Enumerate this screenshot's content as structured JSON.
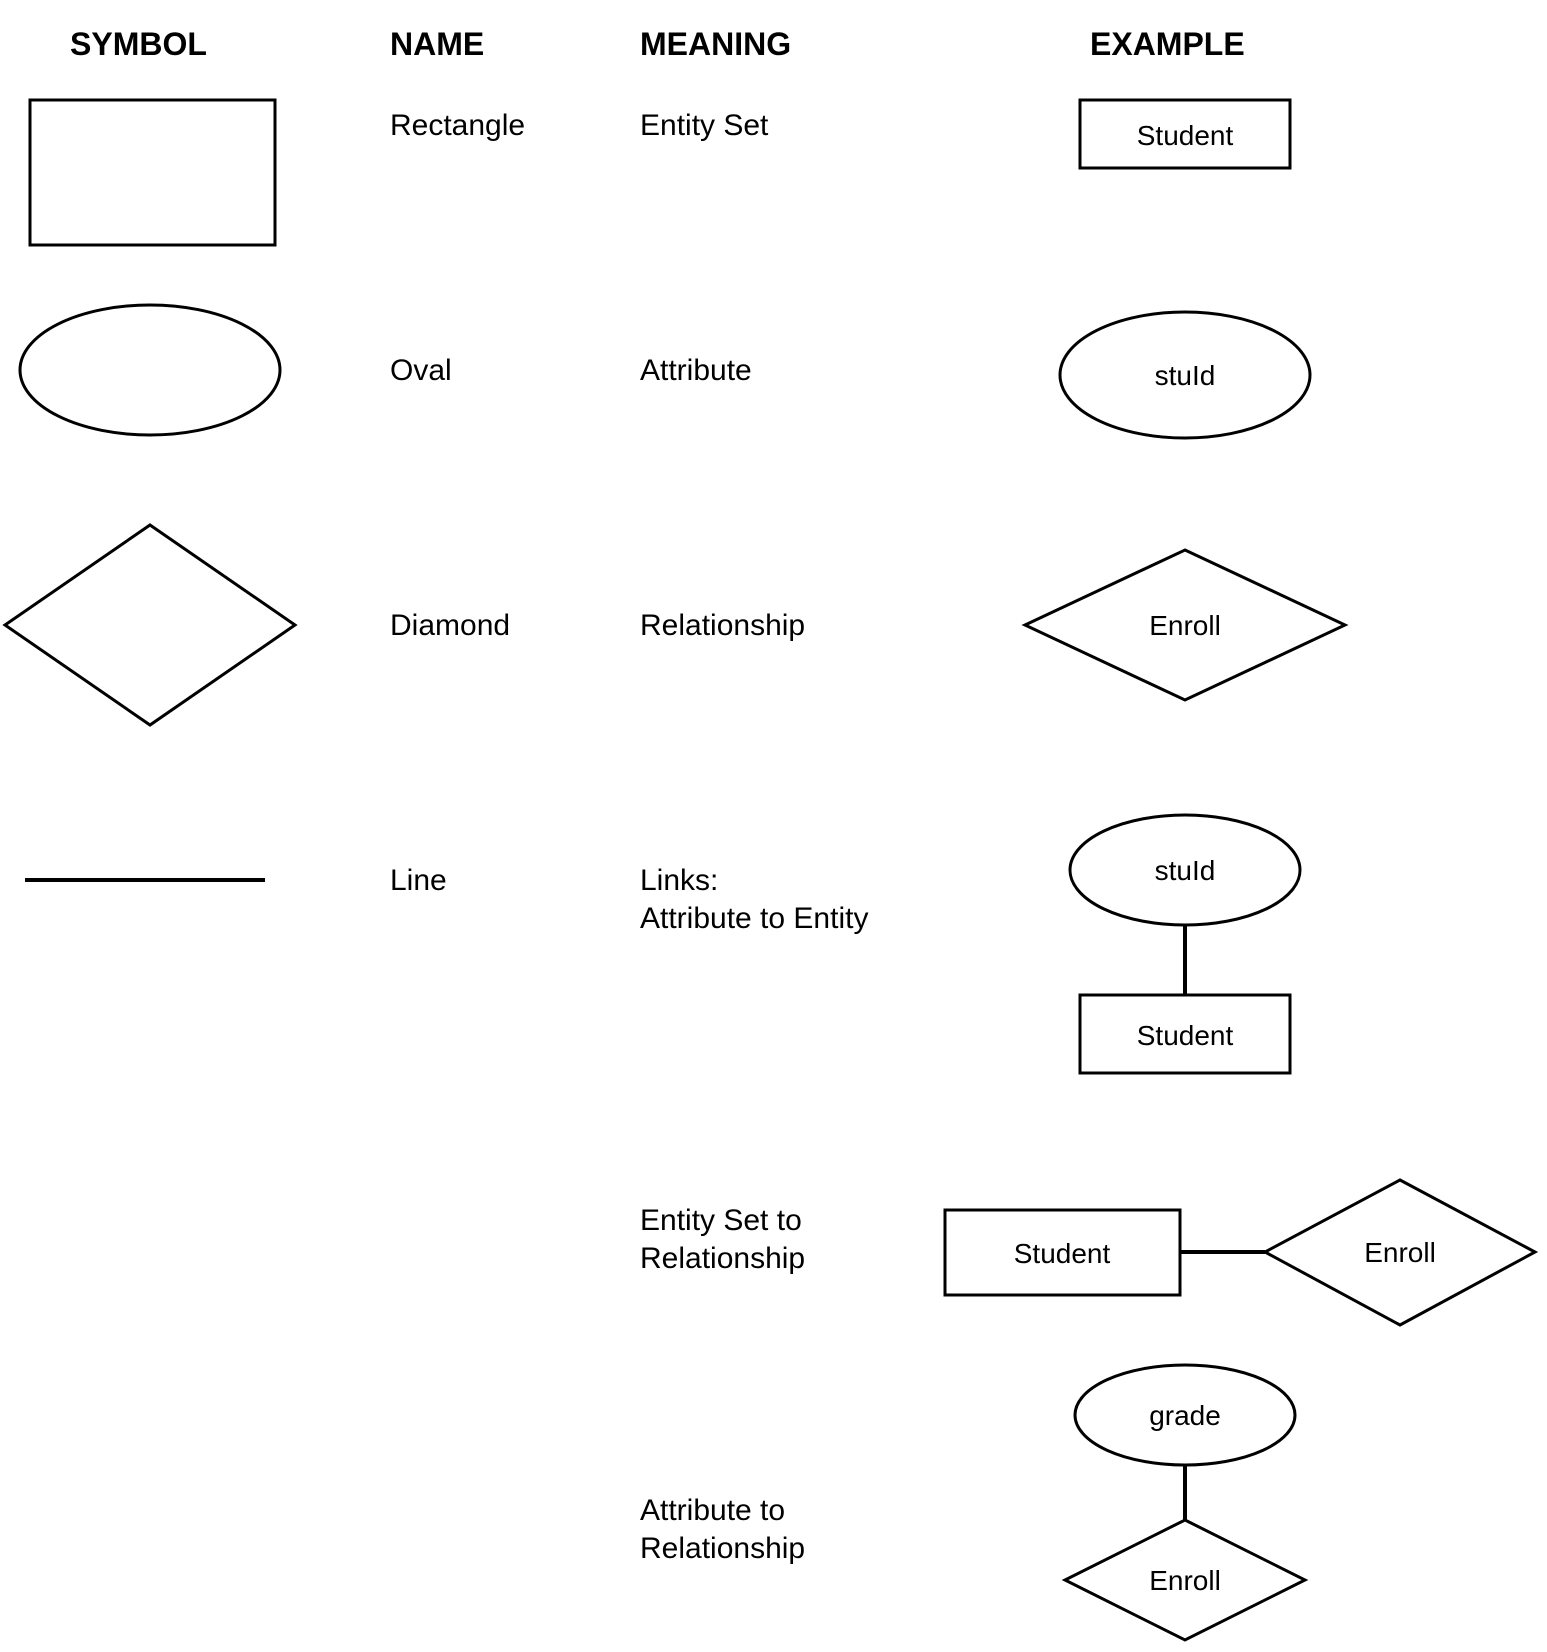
{
  "headers": {
    "symbol": "SYMBOL",
    "name": "NAME",
    "meaning": "MEANING",
    "example": "EXAMPLE"
  },
  "rows": [
    {
      "name": "Rectangle",
      "meaning": "Entity Set",
      "example_label": "Student"
    },
    {
      "name": "Oval",
      "meaning": "Attribute",
      "example_label": "stuId"
    },
    {
      "name": "Diamond",
      "meaning": "Relationship",
      "example_label": "Enroll"
    },
    {
      "name": "Line",
      "meaning_line1": "Links:",
      "meaning_line2": "Attribute to Entity",
      "example_top": "stuId",
      "example_bottom": "Student"
    },
    {
      "meaning_line1": "Entity Set to",
      "meaning_line2": "Relationship",
      "example_left": "Student",
      "example_right": "Enroll"
    },
    {
      "meaning_line1": "Attribute to",
      "meaning_line2": "Relationship",
      "example_top": "grade",
      "example_bottom": "Enroll"
    }
  ]
}
